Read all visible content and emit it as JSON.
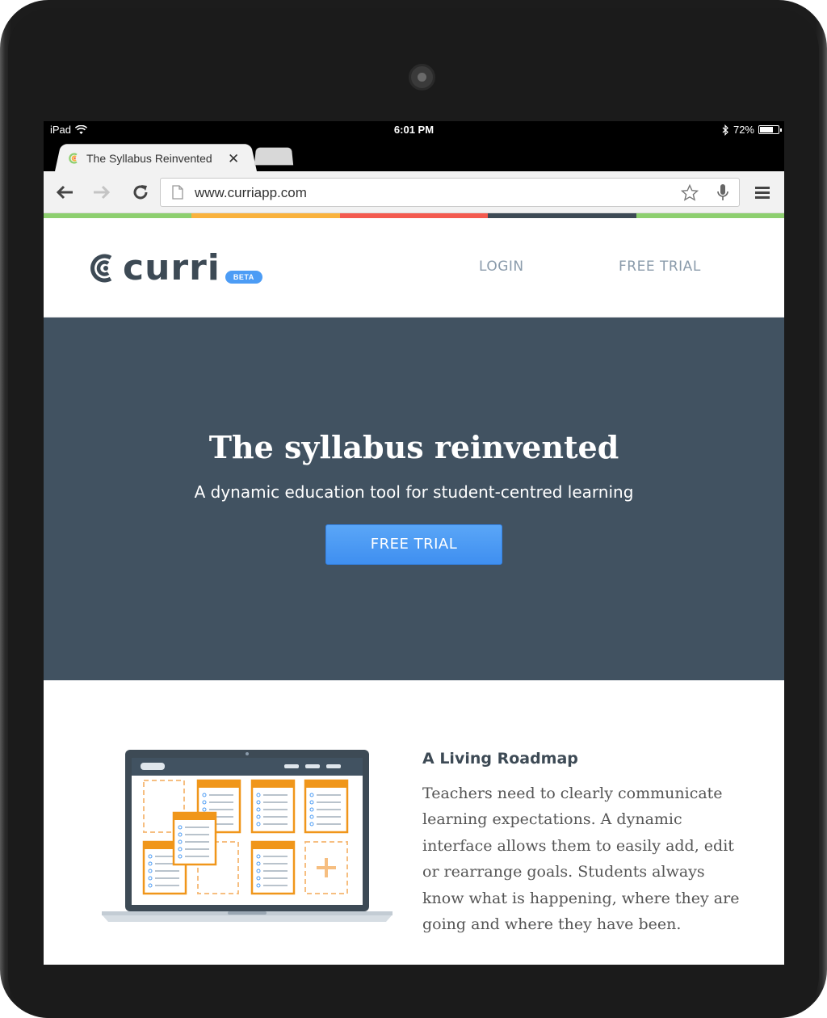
{
  "status_bar": {
    "device": "iPad",
    "time": "6:01 PM",
    "battery": "72%",
    "battery_level": 0.72
  },
  "browser": {
    "tab_title": "The Syllabus Reinvented",
    "url": "www.curriapp.com"
  },
  "stripe_colors": [
    "#8dcf6f",
    "#f9b23d",
    "#f35a4f",
    "#3d4a55",
    "#8dcf6f"
  ],
  "header": {
    "logo_text": "curri",
    "beta_label": "BETA",
    "nav": {
      "login": "LOGIN",
      "free_trial": "FREE TRIAL"
    }
  },
  "hero": {
    "title": "The syllabus reinvented",
    "subtitle": "A dynamic education tool for student-centred learning",
    "cta": "FREE TRIAL"
  },
  "feature": {
    "title": "A Living Roadmap",
    "text": "Teachers need to clearly communicate learning expectations. A dynamic interface allows them to easily add, edit or rearrange goals. Students always know what is happening, where they are going and where they have been."
  },
  "colors": {
    "hero_bg": "#415261",
    "cta": "#4c9cf5",
    "accent_orange": "#f0961a",
    "text_dark": "#3d4a55"
  }
}
